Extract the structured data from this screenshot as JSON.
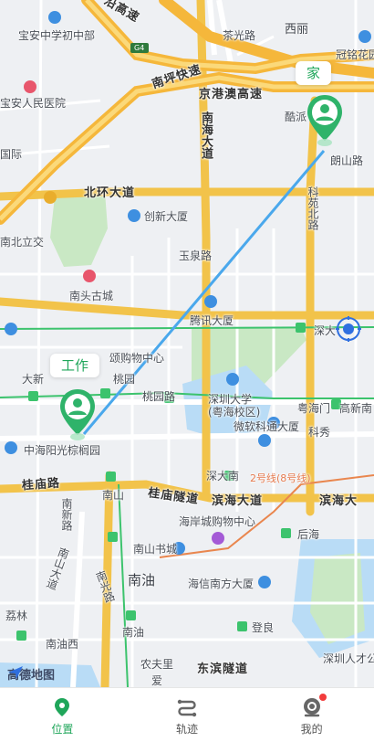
{
  "map": {
    "labels": [
      {
        "text": "宝安中学初中部",
        "cls": ""
      },
      {
        "text": "宝安人民医院",
        "cls": ""
      },
      {
        "text": "国际",
        "cls": ""
      },
      {
        "text": "北环大道",
        "cls": "road"
      },
      {
        "text": "南坪快速",
        "cls": "road"
      },
      {
        "text": "京港澳高速",
        "cls": "road"
      },
      {
        "text": "茶光路",
        "cls": ""
      },
      {
        "text": "西丽",
        "cls": "big"
      },
      {
        "text": "冠铭花园",
        "cls": ""
      },
      {
        "text": "酷派",
        "cls": ""
      },
      {
        "text": "朗山路",
        "cls": ""
      },
      {
        "text": "南海大道",
        "cls": "road vert"
      },
      {
        "text": "科苑北路",
        "cls": "vert"
      },
      {
        "text": "创新大厦",
        "cls": ""
      },
      {
        "text": "南北立交",
        "cls": ""
      },
      {
        "text": "玉泉路",
        "cls": ""
      },
      {
        "text": "南头古城",
        "cls": ""
      },
      {
        "text": "腾讯大厦",
        "cls": ""
      },
      {
        "text": "深大",
        "cls": ""
      },
      {
        "text": "大新",
        "cls": ""
      },
      {
        "text": "桃园",
        "cls": ""
      },
      {
        "text": "桃园路",
        "cls": ""
      },
      {
        "text": "颂购物中心",
        "cls": ""
      },
      {
        "text": "深圳大学(粤海校区)",
        "cls": ""
      },
      {
        "text": "粤海门",
        "cls": ""
      },
      {
        "text": "高新南",
        "cls": ""
      },
      {
        "text": "微软科通大厦",
        "cls": ""
      },
      {
        "text": "科秀",
        "cls": ""
      },
      {
        "text": "中海阳光棕榈园",
        "cls": ""
      },
      {
        "text": "深大南",
        "cls": ""
      },
      {
        "text": "2号线(8号线)",
        "cls": "metro"
      },
      {
        "text": "桂庙路",
        "cls": "road"
      },
      {
        "text": "南山",
        "cls": ""
      },
      {
        "text": "桂庙隧道",
        "cls": "road"
      },
      {
        "text": "滨海大道",
        "cls": "road"
      },
      {
        "text": "滨海大",
        "cls": "road"
      },
      {
        "text": "南新路",
        "cls": "vert"
      },
      {
        "text": "海岸城购物中心",
        "cls": ""
      },
      {
        "text": "后海",
        "cls": ""
      },
      {
        "text": "南山大道",
        "cls": "vert"
      },
      {
        "text": "南山书城",
        "cls": ""
      },
      {
        "text": "南光路",
        "cls": "vert"
      },
      {
        "text": "南油",
        "cls": "big"
      },
      {
        "text": "海信南方大厦",
        "cls": ""
      },
      {
        "text": "荔林",
        "cls": ""
      },
      {
        "text": "南油",
        "cls": ""
      },
      {
        "text": "登良",
        "cls": ""
      },
      {
        "text": "南油西",
        "cls": ""
      },
      {
        "text": "深圳人才公",
        "cls": ""
      },
      {
        "text": "农夫里",
        "cls": ""
      },
      {
        "text": "东滨隧道",
        "cls": "road"
      },
      {
        "text": "爱",
        "cls": ""
      },
      {
        "text": "沿高速",
        "cls": "road"
      }
    ],
    "home_label": "家",
    "work_label": "工作",
    "logo_text": "高德地图",
    "highway_shield": "G4"
  },
  "tabs": [
    {
      "label": "位置",
      "icon": "location-pin-icon",
      "active": true
    },
    {
      "label": "轨迹",
      "icon": "route-icon",
      "active": false
    },
    {
      "label": "我的",
      "icon": "profile-icon",
      "active": false
    }
  ],
  "colors": {
    "accent": "#1fa65a",
    "route_line": "#4aa8ec",
    "highway": "#f2c34a",
    "metro_green": "#3cc36d"
  }
}
